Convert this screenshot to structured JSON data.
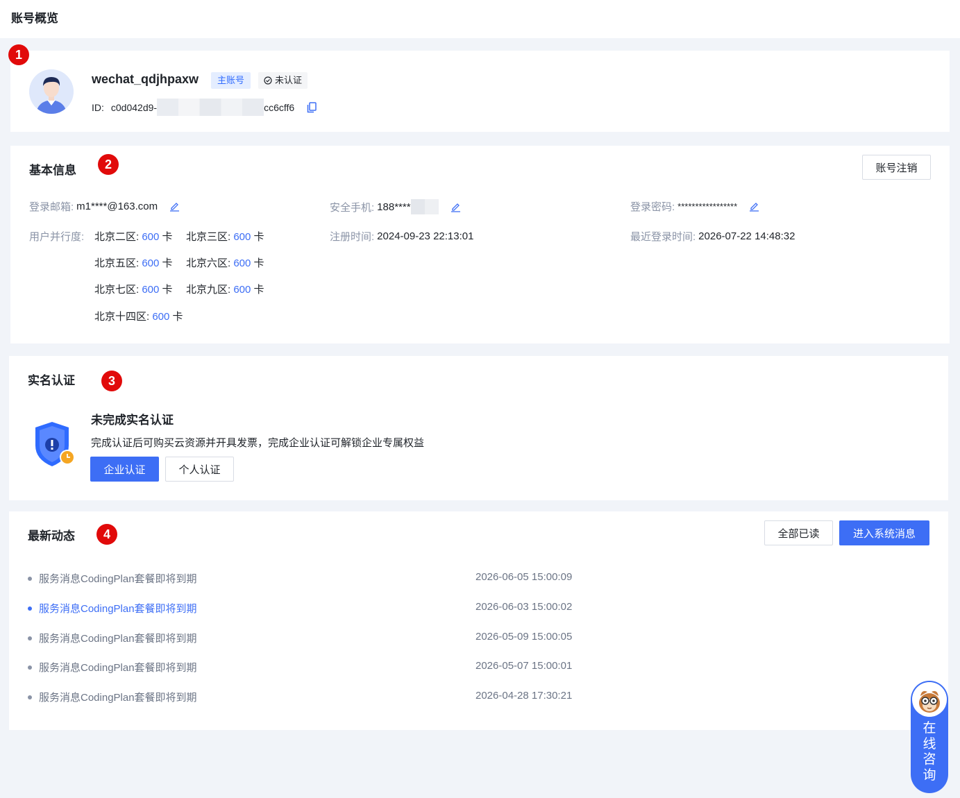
{
  "page": {
    "title": "账号概览"
  },
  "markers": [
    "1",
    "2",
    "3",
    "4"
  ],
  "profile": {
    "username": "wechat_qdjhpaxw",
    "tag_main": "主账号",
    "tag_unverified": "未认证",
    "id_label": "ID:",
    "id_prefix": "c0d042d9-",
    "id_suffix": "cc6cff6"
  },
  "basic": {
    "title": "基本信息",
    "cancel_button": "账号注销",
    "email_label": "登录邮箱:",
    "email_value": "m1****@163.com",
    "phone_label": "安全手机:",
    "phone_value": "188****",
    "password_label": "登录密码:",
    "password_value": "*****************",
    "concurrency_label": "用户并行度:",
    "zones": [
      {
        "name": "北京二区:",
        "count": "600",
        "unit": "卡"
      },
      {
        "name": "北京三区:",
        "count": "600",
        "unit": "卡"
      },
      {
        "name": "北京五区:",
        "count": "600",
        "unit": "卡"
      },
      {
        "name": "北京六区:",
        "count": "600",
        "unit": "卡"
      },
      {
        "name": "北京七区:",
        "count": "600",
        "unit": "卡"
      },
      {
        "name": "北京九区:",
        "count": "600",
        "unit": "卡"
      },
      {
        "name": "北京十四区:",
        "count": "600",
        "unit": "卡"
      }
    ],
    "register_label": "注册时间:",
    "register_value": "2024-09-23 22:13:01",
    "last_login_label": "最近登录时间:",
    "last_login_value": "2026-07-22 14:48:32"
  },
  "verify": {
    "title": "实名认证",
    "status_title": "未完成实名认证",
    "description": "完成认证后可购买云资源并开具发票，完成企业认证可解锁企业专属权益",
    "enterprise_button": "企业认证",
    "personal_button": "个人认证"
  },
  "news": {
    "title": "最新动态",
    "read_all_button": "全部已读",
    "system_messages_button": "进入系统消息",
    "items": [
      {
        "text": "服务消息CodingPlan套餐即将到期",
        "time": "2026-06-05 15:00:09"
      },
      {
        "text": "服务消息CodingPlan套餐即将到期",
        "time": "2026-06-03 15:00:02"
      },
      {
        "text": "服务消息CodingPlan套餐即将到期",
        "time": "2026-05-09 15:00:05"
      },
      {
        "text": "服务消息CodingPlan套餐即将到期",
        "time": "2026-05-07 15:00:01"
      },
      {
        "text": "服务消息CodingPlan套餐即将到期",
        "time": "2026-04-28 17:30:21"
      }
    ]
  },
  "consult": {
    "label": "在线咨询"
  },
  "colors": {
    "primary": "#3d6ef5",
    "marker": "#e10a0a",
    "background": "#f1f4f9"
  }
}
